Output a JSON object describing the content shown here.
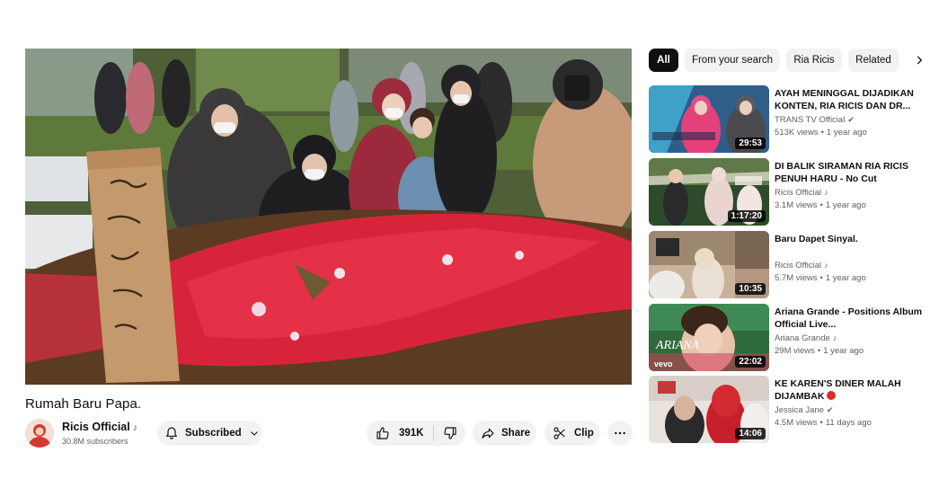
{
  "video": {
    "title": "Rumah Baru Papa."
  },
  "channel": {
    "name": "Ricis Official",
    "note_mark": "♪",
    "subscribers": "30.8M subscribers"
  },
  "actions": {
    "subscribed_label": "Subscribed",
    "likes": "391K",
    "share_label": "Share",
    "clip_label": "Clip"
  },
  "chips": [
    {
      "label": "All"
    },
    {
      "label": "From your search"
    },
    {
      "label": "Ria Ricis"
    },
    {
      "label": "Related"
    }
  ],
  "recommendations": [
    {
      "title": "AYAH MENINGGAL DIJADIKAN KONTEN, RIA RICIS DAN DR...",
      "channel": "TRANS TV Official",
      "channel_mark": "✔",
      "views": "513K views",
      "age": "1 year ago",
      "duration": "29:53"
    },
    {
      "title": "DI BALIK SIRAMAN RIA RICIS PENUH HARU - No Cut",
      "channel": "Ricis Official",
      "channel_mark": "♪",
      "views": "3.1M views",
      "age": "1 year ago",
      "duration": "1:17:20"
    },
    {
      "title": "Baru Dapet Sinyal.",
      "channel": "Ricis Official",
      "channel_mark": "♪",
      "views": "5.7M views",
      "age": "1 year ago",
      "duration": "10:35"
    },
    {
      "title": "Ariana Grande - Positions Album Official Live...",
      "channel": "Ariana Grande",
      "channel_mark": "♪",
      "views": "29M views",
      "age": "1 year ago",
      "duration": "22:02"
    },
    {
      "title": "KE KAREN'S DINER MALAH DIJAMBAK",
      "channel": "Jessica Jane",
      "channel_mark": "✔",
      "views": "4.5M views",
      "age": "11 days ago",
      "duration": "14:06"
    }
  ],
  "thumb_text": {
    "vevo": "vevo",
    "ariana": "ARIANA"
  },
  "colors": {
    "accent_red": "#d93025",
    "chip_bg": "#f2f2f2",
    "text_secondary": "#606060"
  },
  "icons": [
    "bell-icon",
    "chevron-down-icon",
    "thumb-up-icon",
    "thumb-down-icon",
    "share-icon",
    "scissors-icon",
    "more-icon",
    "chevron-right-icon"
  ]
}
